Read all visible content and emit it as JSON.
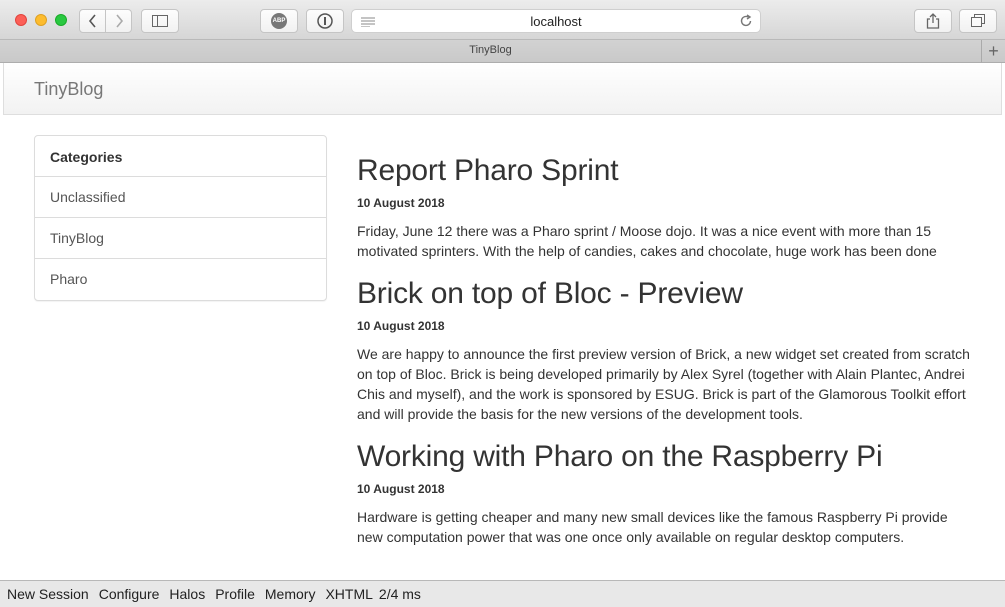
{
  "browser": {
    "address": "localhost",
    "tab_title": "TinyBlog",
    "new_tab": "+",
    "adblock_label": "ABP"
  },
  "navbar": {
    "brand": "TinyBlog"
  },
  "sidebar": {
    "heading": "Categories",
    "items": [
      {
        "label": "Unclassified"
      },
      {
        "label": "TinyBlog"
      },
      {
        "label": "Pharo"
      }
    ]
  },
  "posts": [
    {
      "title": "Report Pharo Sprint",
      "date": "10 August 2018",
      "body": "Friday, June 12 there was a Pharo sprint / Moose dojo. It was a nice event with more than 15 motivated sprinters. With the help of candies, cakes and chocolate, huge work has been done"
    },
    {
      "title": "Brick on top of Bloc - Preview",
      "date": "10 August 2018",
      "body": "We are happy to announce the first preview version of Brick, a new widget set created from scratch on top of Bloc. Brick is being developed primarily by Alex Syrel (together with Alain Plantec, Andrei Chis and myself), and the work is sponsored by ESUG. Brick is part of the Glamorous Toolkit effort and will provide the basis for the new versions of the development tools."
    },
    {
      "title": "Working with Pharo on the Raspberry Pi",
      "date": "10 August 2018",
      "body": "Hardware is getting cheaper and many new small devices like the famous Raspberry Pi provide new computation power that was one once only available on regular desktop computers."
    }
  ],
  "statusbar": {
    "new_session": "New Session",
    "configure": "Configure",
    "halos": "Halos",
    "profile": "Profile",
    "memory": "Memory",
    "xhtml": "XHTML",
    "timing": "2/4 ms"
  }
}
